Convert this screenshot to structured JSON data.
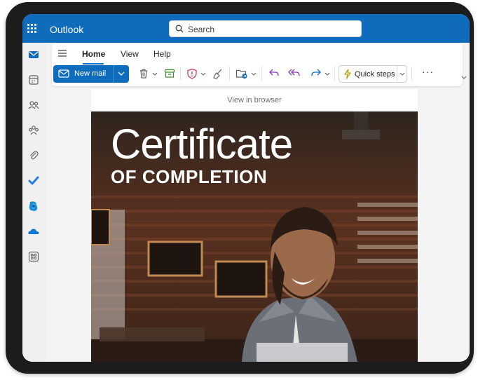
{
  "app": {
    "name": "Outlook",
    "accent": "#0f6cbd"
  },
  "search": {
    "placeholder": "Search"
  },
  "ribbon": {
    "tabs": [
      {
        "label": "Home",
        "active": true
      },
      {
        "label": "View",
        "active": false
      },
      {
        "label": "Help",
        "active": false
      }
    ],
    "new_mail_label": "New mail",
    "quick_steps_label": "Quick steps",
    "more_label": "···"
  },
  "rail_icons": [
    "mail-icon",
    "calendar-icon",
    "people-icon",
    "groups-icon",
    "attachment-icon",
    "todo-icon",
    "microsoft365-icon",
    "onedrive-icon",
    "apps-icon"
  ],
  "toolbar_icons": [
    "delete-icon",
    "archive-icon",
    "report-icon",
    "sweep-icon",
    "move-to-icon",
    "reply-icon",
    "reply-all-icon",
    "forward-icon",
    "lightning-icon"
  ],
  "message": {
    "view_in_browser": "View in browser",
    "headline": "Certificate",
    "subheadline": "OF COMPLETION"
  }
}
